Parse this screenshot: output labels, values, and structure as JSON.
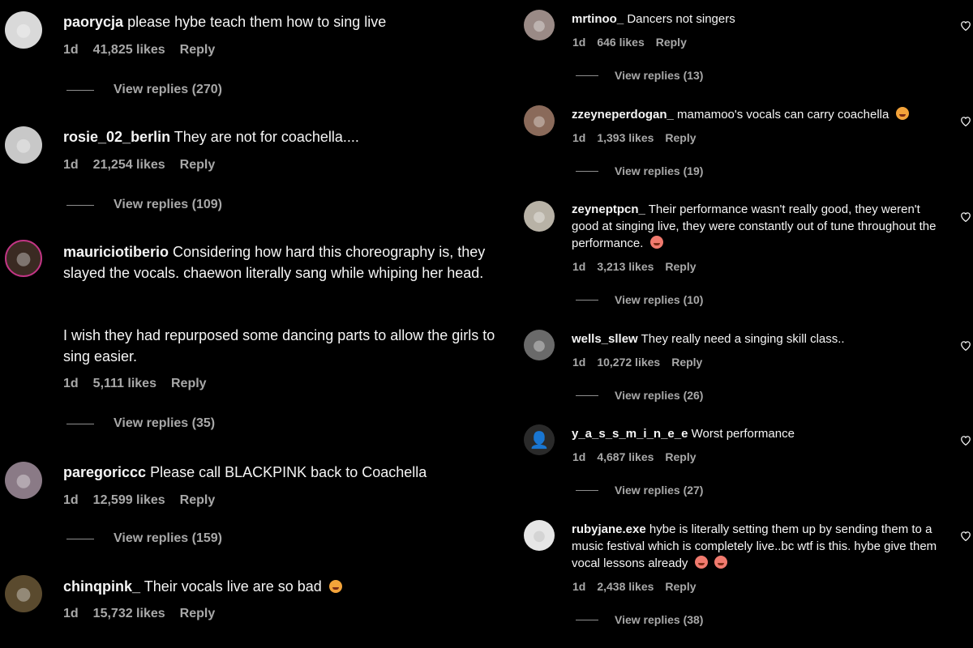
{
  "left": [
    {
      "username": "paorycja",
      "text": "please hybe teach them how to sing live",
      "time": "1d",
      "likes": "41,825 likes",
      "reply": "Reply",
      "view_replies": "View replies (270)",
      "avatar_color": "#d9d9d9"
    },
    {
      "username": "rosie_02_berlin",
      "text": "They are not for coachella....",
      "time": "1d",
      "likes": "21,254 likes",
      "reply": "Reply",
      "view_replies": "View replies (109)",
      "avatar_color": "#c8c8c8"
    },
    {
      "username": "mauriciotiberio",
      "text": "Considering how hard this choreography is, they slayed the vocals. chaewon literally sang while whiping her head.",
      "text2": "I wish they had repurposed some dancing parts to allow the girls to sing easier.",
      "time": "1d",
      "likes": "5,111 likes",
      "reply": "Reply",
      "view_replies": "View replies (35)",
      "avatar_color": "#3a2a22"
    },
    {
      "username": "paregoriccc",
      "text": "Please call BLACKPINK back to Coachella",
      "time": "1d",
      "likes": "12,599 likes",
      "reply": "Reply",
      "view_replies": "View replies (159)",
      "avatar_color": "#8a7a86"
    },
    {
      "username": "chinqpink_",
      "text": "Their vocals live are so bad",
      "time": "1d",
      "likes": "15,732 likes",
      "reply": "Reply",
      "avatar_color": "#5a4a2e"
    }
  ],
  "right": [
    {
      "username": "mrtinoo_",
      "text": "Dancers not singers",
      "time": "1d",
      "likes": "646 likes",
      "reply": "Reply",
      "view_replies": "View replies (13)",
      "avatar_color": "#9a8a86"
    },
    {
      "username": "zzeyneperdogan_",
      "text": "mamamoo's vocals can carry coachella",
      "time": "1d",
      "likes": "1,393 likes",
      "reply": "Reply",
      "view_replies": "View replies (19)",
      "avatar_color": "#8a6a5a"
    },
    {
      "username": "zeyneptpcn_",
      "text": "Their performance wasn't really good, they weren't good at singing live, they were constantly out of tune throughout the performance.",
      "time": "1d",
      "likes": "3,213 likes",
      "reply": "Reply",
      "view_replies": "View replies (10)",
      "avatar_color": "#b8b2a6"
    },
    {
      "username": "wells_sllew",
      "text": "They really need a singing skill class..",
      "time": "1d",
      "likes": "10,272 likes",
      "reply": "Reply",
      "view_replies": "View replies (26)",
      "avatar_color": "#6a6a6a"
    },
    {
      "username": "y_a_s_s_m_i_n_e_e",
      "text": "Worst performance",
      "time": "1d",
      "likes": "4,687 likes",
      "reply": "Reply",
      "view_replies": "View replies (27)",
      "avatar_color": "#2a2a2a"
    },
    {
      "username": "rubyjane.exe",
      "text": "hybe is literally setting them up by sending them to a music festival which is completely live..bc wtf is this. hybe give them vocal lessons already",
      "time": "1d",
      "likes": "2,438 likes",
      "reply": "Reply",
      "view_replies": "View replies (38)",
      "avatar_color": "#e6e6e6"
    }
  ]
}
